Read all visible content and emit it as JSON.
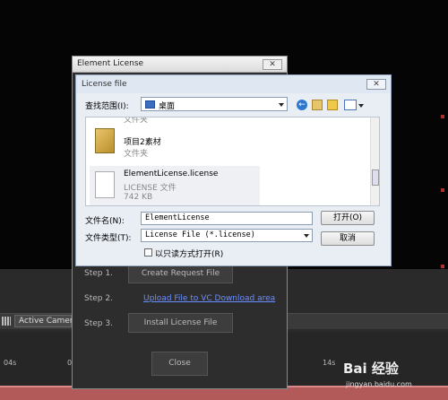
{
  "colors": {
    "app_background": "#050505",
    "timeline_bar": "#b25a5a",
    "link": "#6a8fff",
    "file_dialog_background": "#e9eef5",
    "element_dialog_background": "#2d2d2d"
  },
  "ae": {
    "camera_button": "Active Camera",
    "ruler_ticks": [
      "04s",
      "0",
      "14s"
    ]
  },
  "element_dialog": {
    "title": "Element License",
    "close_icon": "close-icon",
    "step1_label": "Step 1.",
    "step1_button": "Create Request File",
    "step2_label": "Step 2.",
    "step2_link": "Upload File to VC Download area",
    "step3_label": "Step 3.",
    "step3_button": "Install License File",
    "close_button": "Close"
  },
  "file_dialog": {
    "title": "License file",
    "look_in_label": "查找范围(I):",
    "look_in_value": "桌面",
    "toolbar_icons": [
      "back-icon",
      "up-folder-icon",
      "new-folder-icon",
      "view-menu-icon"
    ],
    "items": [
      {
        "icon": "folder-icon",
        "name": "文件夹",
        "sub": ""
      },
      {
        "icon": "folder-icon",
        "name": "项目2素材",
        "sub": "文件夹"
      },
      {
        "icon": "file-icon",
        "name": "ElementLicense.license",
        "sub": "LICENSE 文件",
        "size": "742 KB"
      }
    ],
    "filename_label": "文件名(N):",
    "filename_value": "ElementLicense",
    "filetype_label": "文件类型(T):",
    "filetype_value": "License File (*.license)",
    "open_button": "打开(O)",
    "cancel_button": "取消",
    "readonly_label": "以只读方式打开(R)"
  },
  "watermark": {
    "text": "Bai 经验",
    "url": "jingyan.baidu.com"
  }
}
